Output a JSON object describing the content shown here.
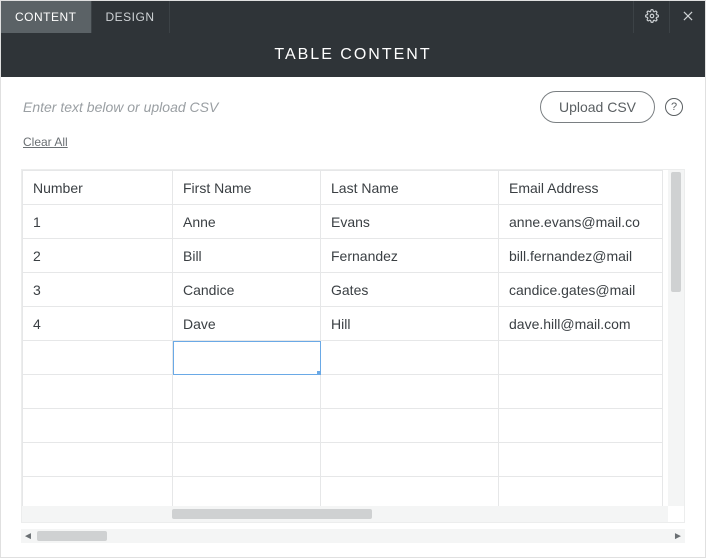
{
  "tabs": {
    "content": "CONTENT",
    "design": "DESIGN"
  },
  "title": "TABLE CONTENT",
  "hint": "Enter text below or upload CSV",
  "upload_label": "Upload CSV",
  "clear_all": "Clear All",
  "table": {
    "headers": [
      "Number",
      "First Name",
      "Last Name",
      "Email Address"
    ],
    "rows": [
      [
        "1",
        "Anne",
        "Evans",
        "anne.evans@mail.co"
      ],
      [
        "2",
        "Bill",
        "Fernandez",
        "bill.fernandez@mail"
      ],
      [
        "3",
        "Candice",
        "Gates",
        "candice.gates@mail"
      ],
      [
        "4",
        "Dave",
        "Hill",
        "dave.hill@mail.com"
      ]
    ],
    "empty_rows": 5,
    "selected_cell": {
      "row": 4,
      "col": 1
    }
  }
}
